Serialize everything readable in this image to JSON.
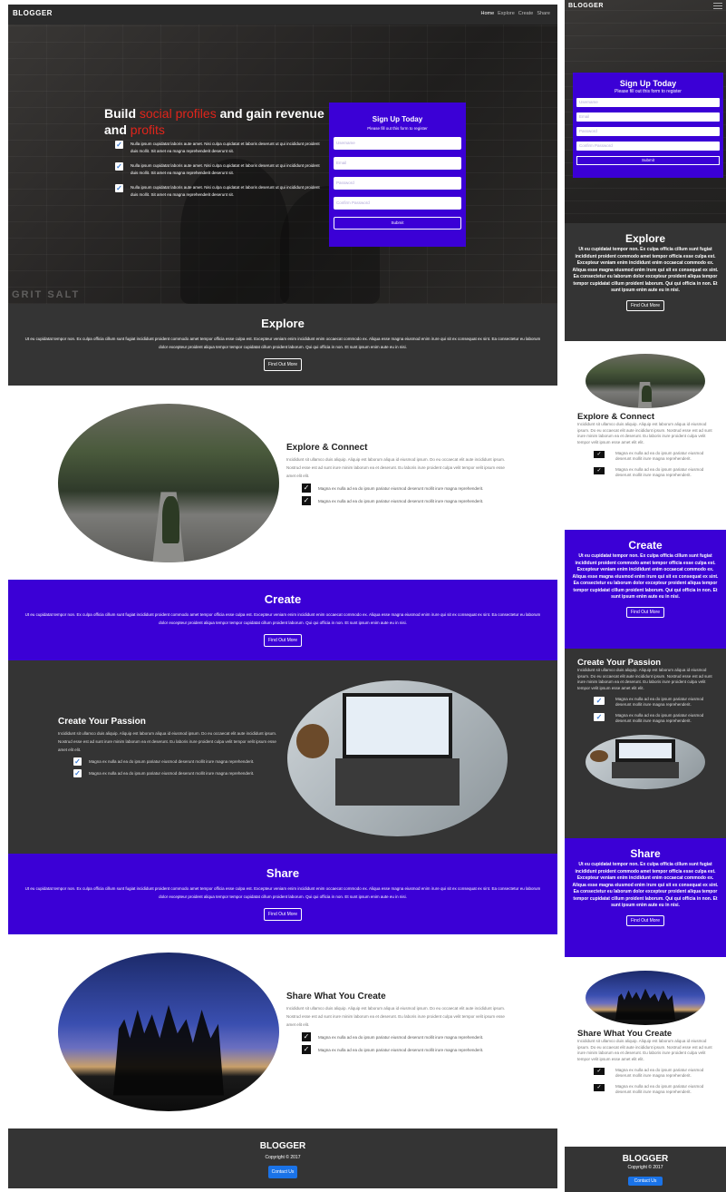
{
  "brand": "BLOGGER",
  "nav": {
    "links": [
      "Home",
      "Explore",
      "Create",
      "Share"
    ]
  },
  "hero": {
    "headline_pre": "Build ",
    "headline_highlight": "social profiles",
    "headline_post": " and gain revenue and ",
    "headline_end": "profits",
    "checks": [
      "Nulla ipsum cupidatat laboris aute amet. Nisi culpa cupidatat et laboris deserunt ut qui incididunt proident duis mollit. Sit amet ea magna reprehenderit deserunt sit.",
      "Nulla ipsum cupidatat laboris aute amet. Nisi culpa cupidatat et laboris deserunt ut qui incididunt proident duis mollit. Sit amet ea magna reprehenderit deserunt sit.",
      "Nulla ipsum cupidatat laboris aute amet. Nisi culpa cupidatat et laboris deserunt ut qui incididunt proident duis mollit. Sit amet ea magna reprehenderit deserunt sit."
    ],
    "watermark": "GRIT SALT"
  },
  "signup": {
    "title": "Sign Up Today",
    "subtitle": "Please fill out this form to register",
    "username_placeholder": "Username",
    "email_placeholder": "Email",
    "password_placeholder": "Password",
    "confirm_placeholder": "Confirm Password",
    "submit": "Submit"
  },
  "band_text": "Ut eu cupidatat tempor non. Ex culpa officia cillum sunt fugiat incididunt proident commodo amet tempor officia esse culpa est. Excepteur veniam enim incididunt enim occaecat commodo ex. Aliqua esse magna eiusmod enim irure qui sit ex consequat ex sint. Ea consectetur eu laborum dolor excepteur proident aliqua tempor tempor cupidatat cillum proident laborum. Qui qui officia in non. Et sunt ipsum enim aute eu in nisi.",
  "find_out_more": "Find Out More",
  "explore": {
    "title": "Explore"
  },
  "create": {
    "title": "Create"
  },
  "share": {
    "title": "Share"
  },
  "feature_text": "Incididunt sit ullamco duis aliquip. Aliquip est laborum aliqua id eiusmod ipsum. Do eu occaecat elit aute incididunt ipsum. Nostrud esse est ad sunt irure minim laborum ea et deserunt. Eu laboris irure proident culpa velit tempor velit ipsum esse amet elit elit.",
  "feature_check": "Magna ex nulla ad ea do ipsum pariatur eiusmod deserunt mollit irure magna reprehenderit.",
  "features": {
    "explore_connect": "Explore & Connect",
    "create_passion": "Create Your Passion",
    "share_create": "Share What You Create"
  },
  "footer": {
    "brand": "BLOGGER",
    "copyright": "Copyright © 2017",
    "contact": "Contact Us"
  },
  "colors": {
    "purple": "#3b00d6",
    "dark": "#343434",
    "red": "#e0251b",
    "blue": "#1a73e8"
  }
}
